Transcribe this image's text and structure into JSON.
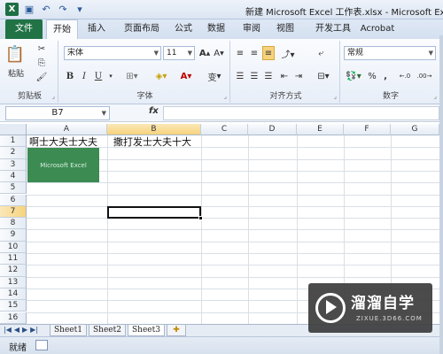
{
  "window": {
    "title": "新建 Microsoft Excel 工作表.xlsx - Microsoft Excel"
  },
  "tabs": [
    {
      "label": "文件",
      "type": "file"
    },
    {
      "label": "开始",
      "type": "active"
    },
    {
      "label": "插入"
    },
    {
      "label": "页面布局"
    },
    {
      "label": "公式"
    },
    {
      "label": "数据"
    },
    {
      "label": "审阅"
    },
    {
      "label": "视图"
    },
    {
      "label": "开发工具"
    },
    {
      "label": "Acrobat"
    }
  ],
  "ribbon": {
    "clipboard": {
      "paste_label": "粘贴",
      "group_label": "剪贴板"
    },
    "font": {
      "font_name": "宋体",
      "font_size": "11",
      "group_label": "字体",
      "bold": "B",
      "italic": "I",
      "underline": "U",
      "color_a": "A",
      "wen": "变"
    },
    "alignment": {
      "group_label": "对齐方式"
    },
    "number": {
      "format": "常规",
      "group_label": "数字",
      "percent": "%",
      "comma": ","
    }
  },
  "formula_bar": {
    "name_box": "B7",
    "fx": "fx",
    "formula": ""
  },
  "grid": {
    "columns": [
      "A",
      "B",
      "C",
      "D",
      "E",
      "F",
      "G"
    ],
    "selected_column": "B",
    "rows": [
      "1",
      "2",
      "3",
      "4",
      "5",
      "6",
      "7",
      "8",
      "9",
      "10",
      "11",
      "12",
      "13",
      "14",
      "15",
      "16"
    ],
    "selected_row": "7",
    "cells": {
      "A1": "啊士大夫士大夫",
      "B1": "撒打发士大夫十大"
    },
    "image_text": "Microsoft Excel"
  },
  "sheets": [
    {
      "label": "Sheet1"
    },
    {
      "label": "Sheet2"
    },
    {
      "label": "Sheet3",
      "active": true
    }
  ],
  "nav_buttons": [
    "◀",
    "◀",
    "▶",
    "▶"
  ],
  "status": {
    "text": "就绪"
  },
  "watermark": {
    "title": "溜溜自学",
    "subtitle": "ZIXUE.3D66.COM"
  },
  "colors": {
    "file_tab": "#217346",
    "selection_header": "#f6d27d"
  }
}
